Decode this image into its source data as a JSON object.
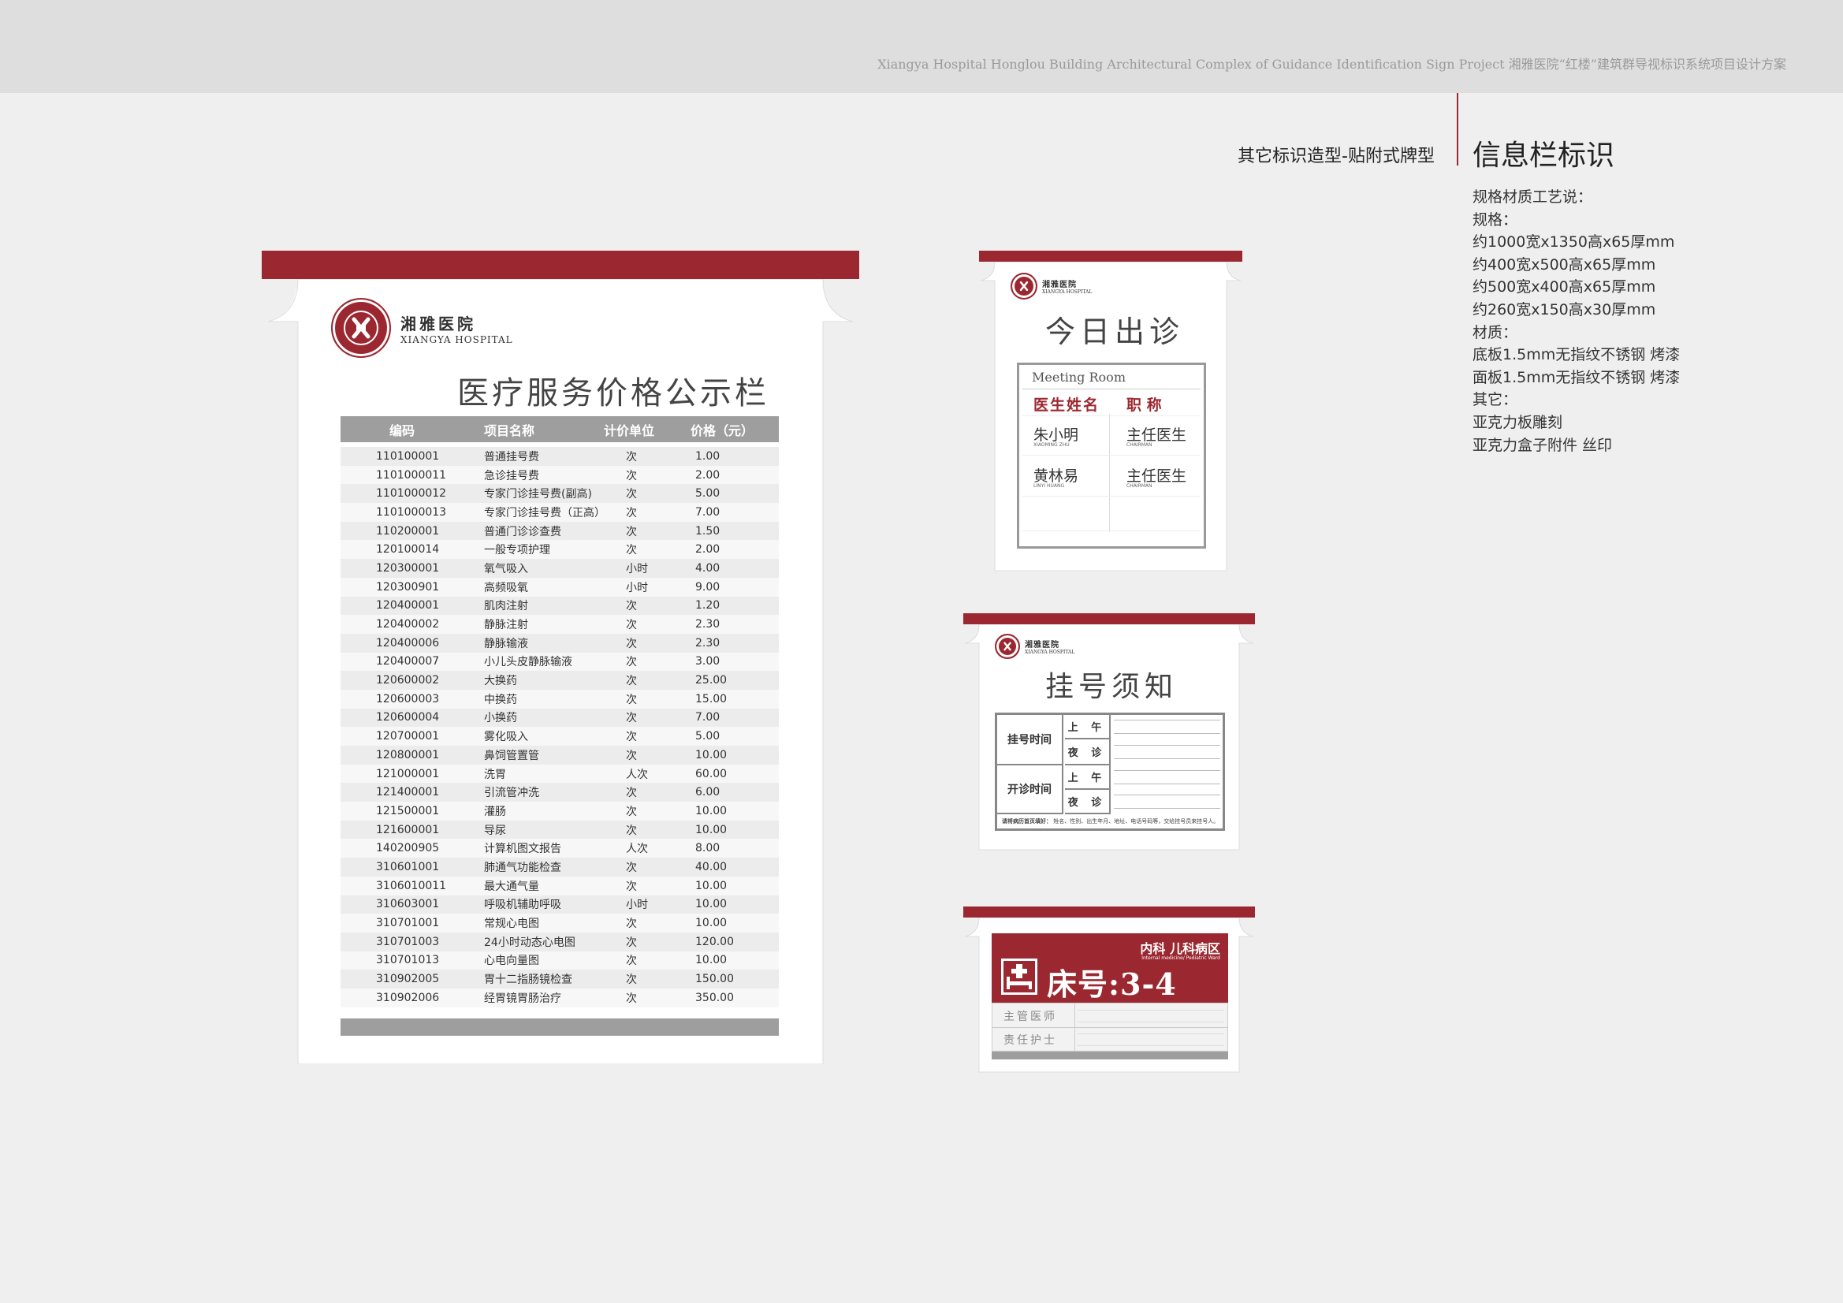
{
  "header": {
    "title": "Xiangya Hospital Honglou Building Architectural Complex of Guidance Identification Sign Project   湘雅医院“红楼”建筑群导视标识系统项目设计方案"
  },
  "page": {
    "subtitle": "其它标识造型-贴附式牌型",
    "section_title": "信息栏标识",
    "specs": [
      "规格材质工艺说：",
      "规格：",
      "约1000宽x1350高x65厚mm",
      "约400宽x500高x65厚mm",
      "约500宽x400高x65厚mm",
      "约260宽x150高x30厚mm",
      "材质：",
      "底板1.5mm无指纹不锈钢 烤漆",
      "面板1.5mm无指纹不锈钢 烤漆",
      "其它：",
      "亚克力板雕刻",
      "亚克力盒子附件 丝印"
    ],
    "brand_color": "#9b2830"
  },
  "logo": {
    "cn": "湘雅医院",
    "en": "XIANGYA HOSPITAL"
  },
  "price_board": {
    "title": "医疗服务价格公示栏",
    "columns": [
      "编码",
      "项目名称",
      "计价单位",
      "价格（元）"
    ],
    "rows": [
      [
        "110100001",
        "普通挂号费",
        "次",
        "1.00"
      ],
      [
        "1101000011",
        "急诊挂号费",
        "次",
        "2.00"
      ],
      [
        "1101000012",
        "专家门诊挂号费(副高)",
        "次",
        "5.00"
      ],
      [
        "1101000013",
        "专家门诊挂号费（正高）",
        "次",
        "7.00"
      ],
      [
        "110200001",
        "普通门诊诊查费",
        "次",
        "1.50"
      ],
      [
        "120100014",
        "一般专项护理",
        "次",
        "2.00"
      ],
      [
        "120300001",
        "氧气吸入",
        "小时",
        "4.00"
      ],
      [
        "120300901",
        "高频吸氧",
        "小时",
        "9.00"
      ],
      [
        "120400001",
        "肌肉注射",
        "次",
        "1.20"
      ],
      [
        "120400002",
        "静脉注射",
        "次",
        "2.30"
      ],
      [
        "120400006",
        "静脉输液",
        "次",
        "2.30"
      ],
      [
        "120400007",
        "小儿头皮静脉输液",
        "次",
        "3.00"
      ],
      [
        "120600002",
        "大换药",
        "次",
        "25.00"
      ],
      [
        "120600003",
        "中换药",
        "次",
        "15.00"
      ],
      [
        "120600004",
        "小换药",
        "次",
        "7.00"
      ],
      [
        "120700001",
        "雾化吸入",
        "次",
        "5.00"
      ],
      [
        "120800001",
        "鼻饲管置管",
        "次",
        "10.00"
      ],
      [
        "121000001",
        "洗胃",
        "人次",
        "60.00"
      ],
      [
        "121400001",
        "引流管冲洗",
        "次",
        "6.00"
      ],
      [
        "121500001",
        "灌肠",
        "次",
        "10.00"
      ],
      [
        "121600001",
        "导尿",
        "次",
        "10.00"
      ],
      [
        "140200905",
        "计算机图文报告",
        "人次",
        "8.00"
      ],
      [
        "310601001",
        "肺通气功能检查",
        "次",
        "40.00"
      ],
      [
        "3106010011",
        "最大通气量",
        "次",
        "10.00"
      ],
      [
        "310603001",
        "呼吸机辅助呼吸",
        "小时",
        "10.00"
      ],
      [
        "310701001",
        "常规心电图",
        "次",
        "10.00"
      ],
      [
        "310701003",
        "24小时动态心电图",
        "次",
        "120.00"
      ],
      [
        "310701013",
        "心电向量图",
        "次",
        "10.00"
      ],
      [
        "310902005",
        "胃十二指肠镜检查",
        "次",
        "150.00"
      ],
      [
        "310902006",
        "经胃镜胃肠治疗",
        "次",
        "350.00"
      ]
    ]
  },
  "clinic_board": {
    "title": "今日出诊",
    "room_label": "Meeting Room",
    "col_doctor": "医生姓名",
    "col_title": "职 称",
    "doctors": [
      {
        "name": "朱小明",
        "name_en": "XIAOMING ZHU",
        "title": "主任医生",
        "title_en": "CHAIRMAN"
      },
      {
        "name": "黄林易",
        "name_en": "LINYI HUANG",
        "title": "主任医生",
        "title_en": "CHAIRMAN"
      }
    ]
  },
  "registration_board": {
    "title": "挂号须知",
    "reg_time": "挂号时间",
    "open_time": "开诊时间",
    "am": "上 午",
    "night": "夜 诊",
    "note_bold": "请将病历首页填好：",
    "note": "姓名、性别、出生年月、地址、电话号码等，交给挂号员来挂号人。"
  },
  "bed_board": {
    "dept": "内科 儿科病区",
    "dept_en": "Internal medicine/ Pediatric Ward",
    "bed_label": "床号:3-4",
    "doctor": "主管医师",
    "nurse": "责任护士"
  }
}
